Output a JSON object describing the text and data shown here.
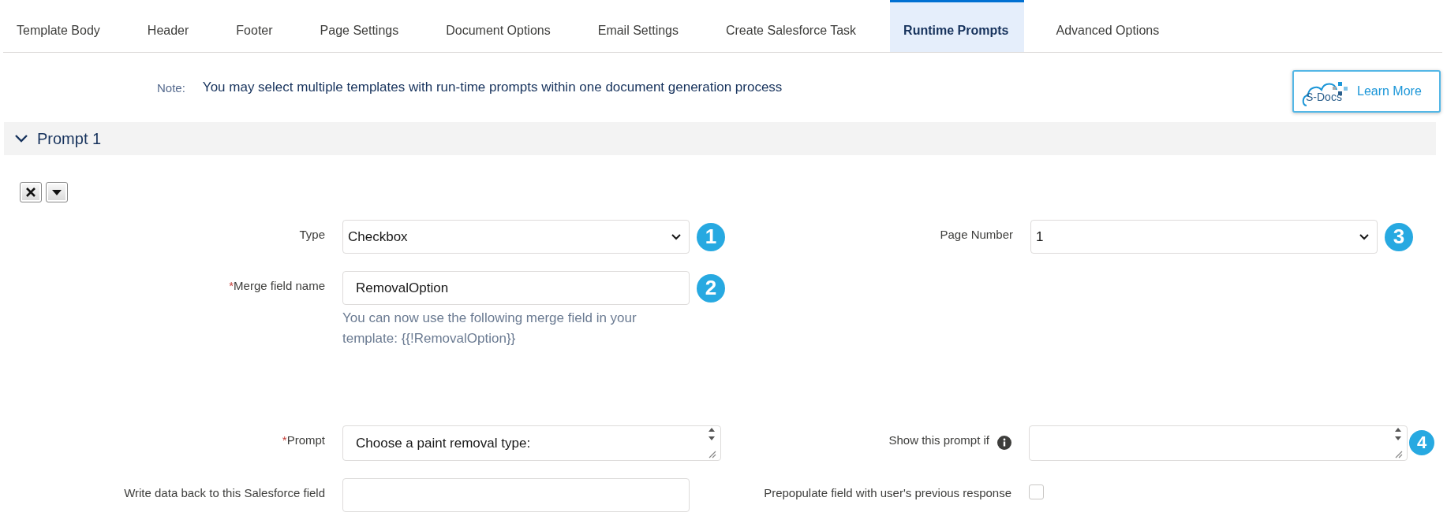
{
  "tabs": [
    {
      "label": "Template Body",
      "selected": false
    },
    {
      "label": "Header",
      "selected": false
    },
    {
      "label": "Footer",
      "selected": false
    },
    {
      "label": "Page Settings",
      "selected": false
    },
    {
      "label": "Document Options",
      "selected": false
    },
    {
      "label": "Email Settings",
      "selected": false
    },
    {
      "label": "Create Salesforce Task",
      "selected": false
    },
    {
      "label": "Runtime Prompts",
      "selected": true
    },
    {
      "label": "Advanced Options",
      "selected": false
    }
  ],
  "note": {
    "label": "Note:",
    "text": "You may select multiple templates with run-time prompts within one document generation process"
  },
  "learn_more_button": {
    "logo_text": "S-Docs",
    "label": "Learn More"
  },
  "section": {
    "title": "Prompt 1",
    "expanded": true
  },
  "rows": [
    {
      "left": {
        "kind": "select",
        "label": "Type",
        "value": "Checkbox",
        "badge": "1"
      },
      "right": {
        "kind": "select",
        "label": "Page Number",
        "value": "1",
        "badge": "3"
      }
    },
    {
      "left": {
        "kind": "text",
        "required_mark": "*",
        "label": "Merge field name",
        "value": "RemovalOption",
        "badge": "2",
        "help": "You can now use the following merge field in your template: {{!RemovalOption}}"
      }
    },
    {
      "left": {
        "kind": "textarea",
        "required_mark": "*",
        "label": "Prompt",
        "value": "Choose a paint removal type:"
      },
      "right": {
        "kind": "textarea",
        "label": "Show this prompt if",
        "info": true,
        "badge": "4"
      }
    },
    {
      "left": {
        "kind": "text",
        "label": "Write data back to this Salesforce field"
      },
      "right": {
        "kind": "checkbox",
        "label": "Prepopulate field with user's previous response",
        "checked": false
      }
    }
  ]
}
